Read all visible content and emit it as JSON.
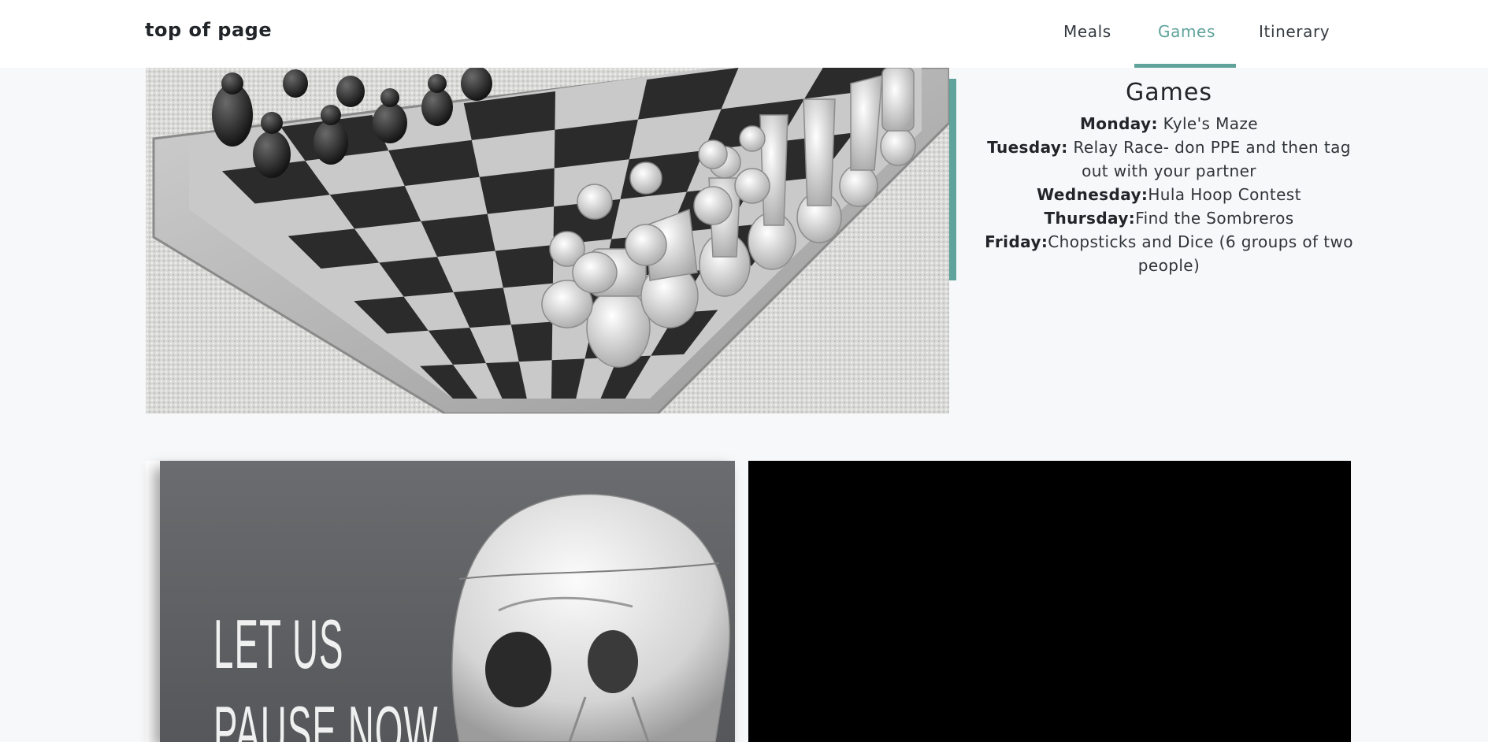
{
  "navbar": {
    "brand": "top of page",
    "links": [
      {
        "label": "Meals",
        "active": false
      },
      {
        "label": "Games",
        "active": true
      },
      {
        "label": "Itinerary",
        "active": false
      }
    ]
  },
  "games": {
    "title": "Games",
    "schedule": [
      {
        "day": "Monday:",
        "activity": " Kyle's Maze"
      },
      {
        "day": "Tuesday:",
        "activity": " Relay Race- don PPE and then tag out with your partner"
      },
      {
        "day": "Wednesday:",
        "activity": "Hula Hoop Contest"
      },
      {
        "day": "Thursday:",
        "activity": "Find the Sombreros"
      },
      {
        "day": "Friday:",
        "activity": "Chopsticks and Dice (6 groups of two people)"
      }
    ]
  },
  "poster": {
    "line1": "LET US",
    "line2": "PAUSE NOW"
  },
  "colors": {
    "accent": "#5fa39a",
    "background": "#f7f8f9",
    "video": "#000000"
  }
}
